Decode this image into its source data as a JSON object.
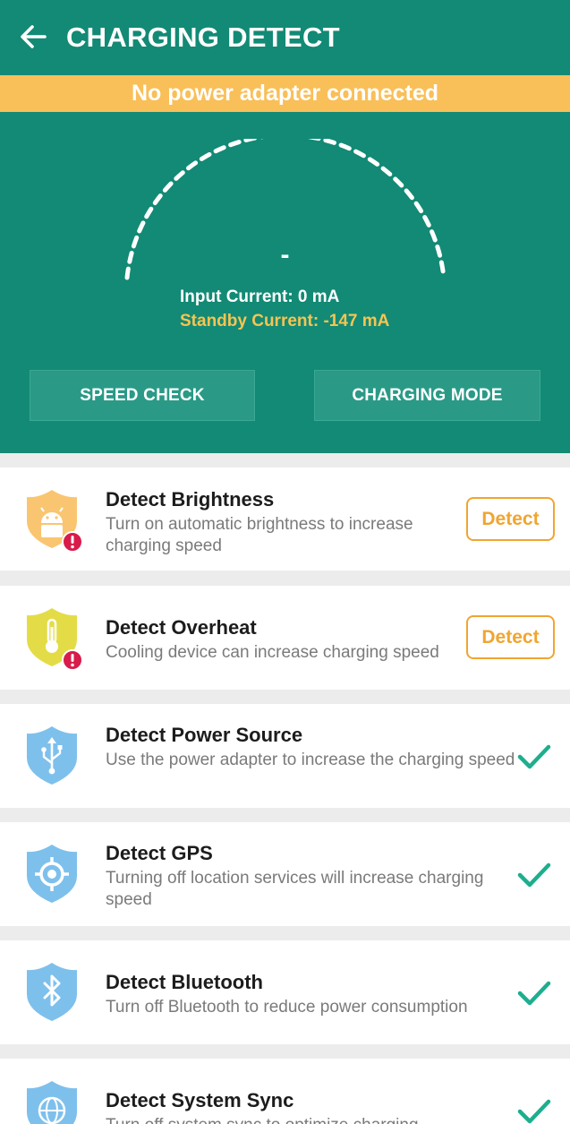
{
  "app": {
    "title": "CHARGING DETECT"
  },
  "banner": {
    "text": "No power adapter connected"
  },
  "gauge": {
    "value": "-",
    "input_current": "Input Current: 0 mA",
    "standby_current": "Standby Current: -147 mA"
  },
  "buttons": {
    "speed_check": "SPEED CHECK",
    "charging_mode": "CHARGING MODE"
  },
  "colors": {
    "primary": "#128a75",
    "banner": "#f9bf58",
    "accent_orange": "#f0a531",
    "check_green": "#1dae8e",
    "alert_red": "#d81b4a",
    "icon_blue": "#7ec0ec"
  },
  "items": [
    {
      "title": "Detect Brightness",
      "desc": "Turn on automatic brightness to increase charging speed",
      "icon": "android-shield-icon",
      "status": "detect",
      "action_label": "Detect"
    },
    {
      "title": "Detect Overheat",
      "desc": "Cooling device can increase charging speed",
      "icon": "thermometer-shield-icon",
      "status": "detect",
      "action_label": "Detect"
    },
    {
      "title": "Detect Power Source",
      "desc": "Use the power adapter to increase the charging speed",
      "icon": "usb-shield-icon",
      "status": "ok"
    },
    {
      "title": "Detect GPS",
      "desc": "Turning off location services will increase charging speed",
      "icon": "gps-shield-icon",
      "status": "ok"
    },
    {
      "title": "Detect Bluetooth",
      "desc": "Turn off Bluetooth to reduce power consumption",
      "icon": "bluetooth-shield-icon",
      "status": "ok"
    },
    {
      "title": "Detect System Sync",
      "desc": "Turn off system sync to optimize charging",
      "icon": "globe-shield-icon",
      "status": "ok"
    }
  ]
}
